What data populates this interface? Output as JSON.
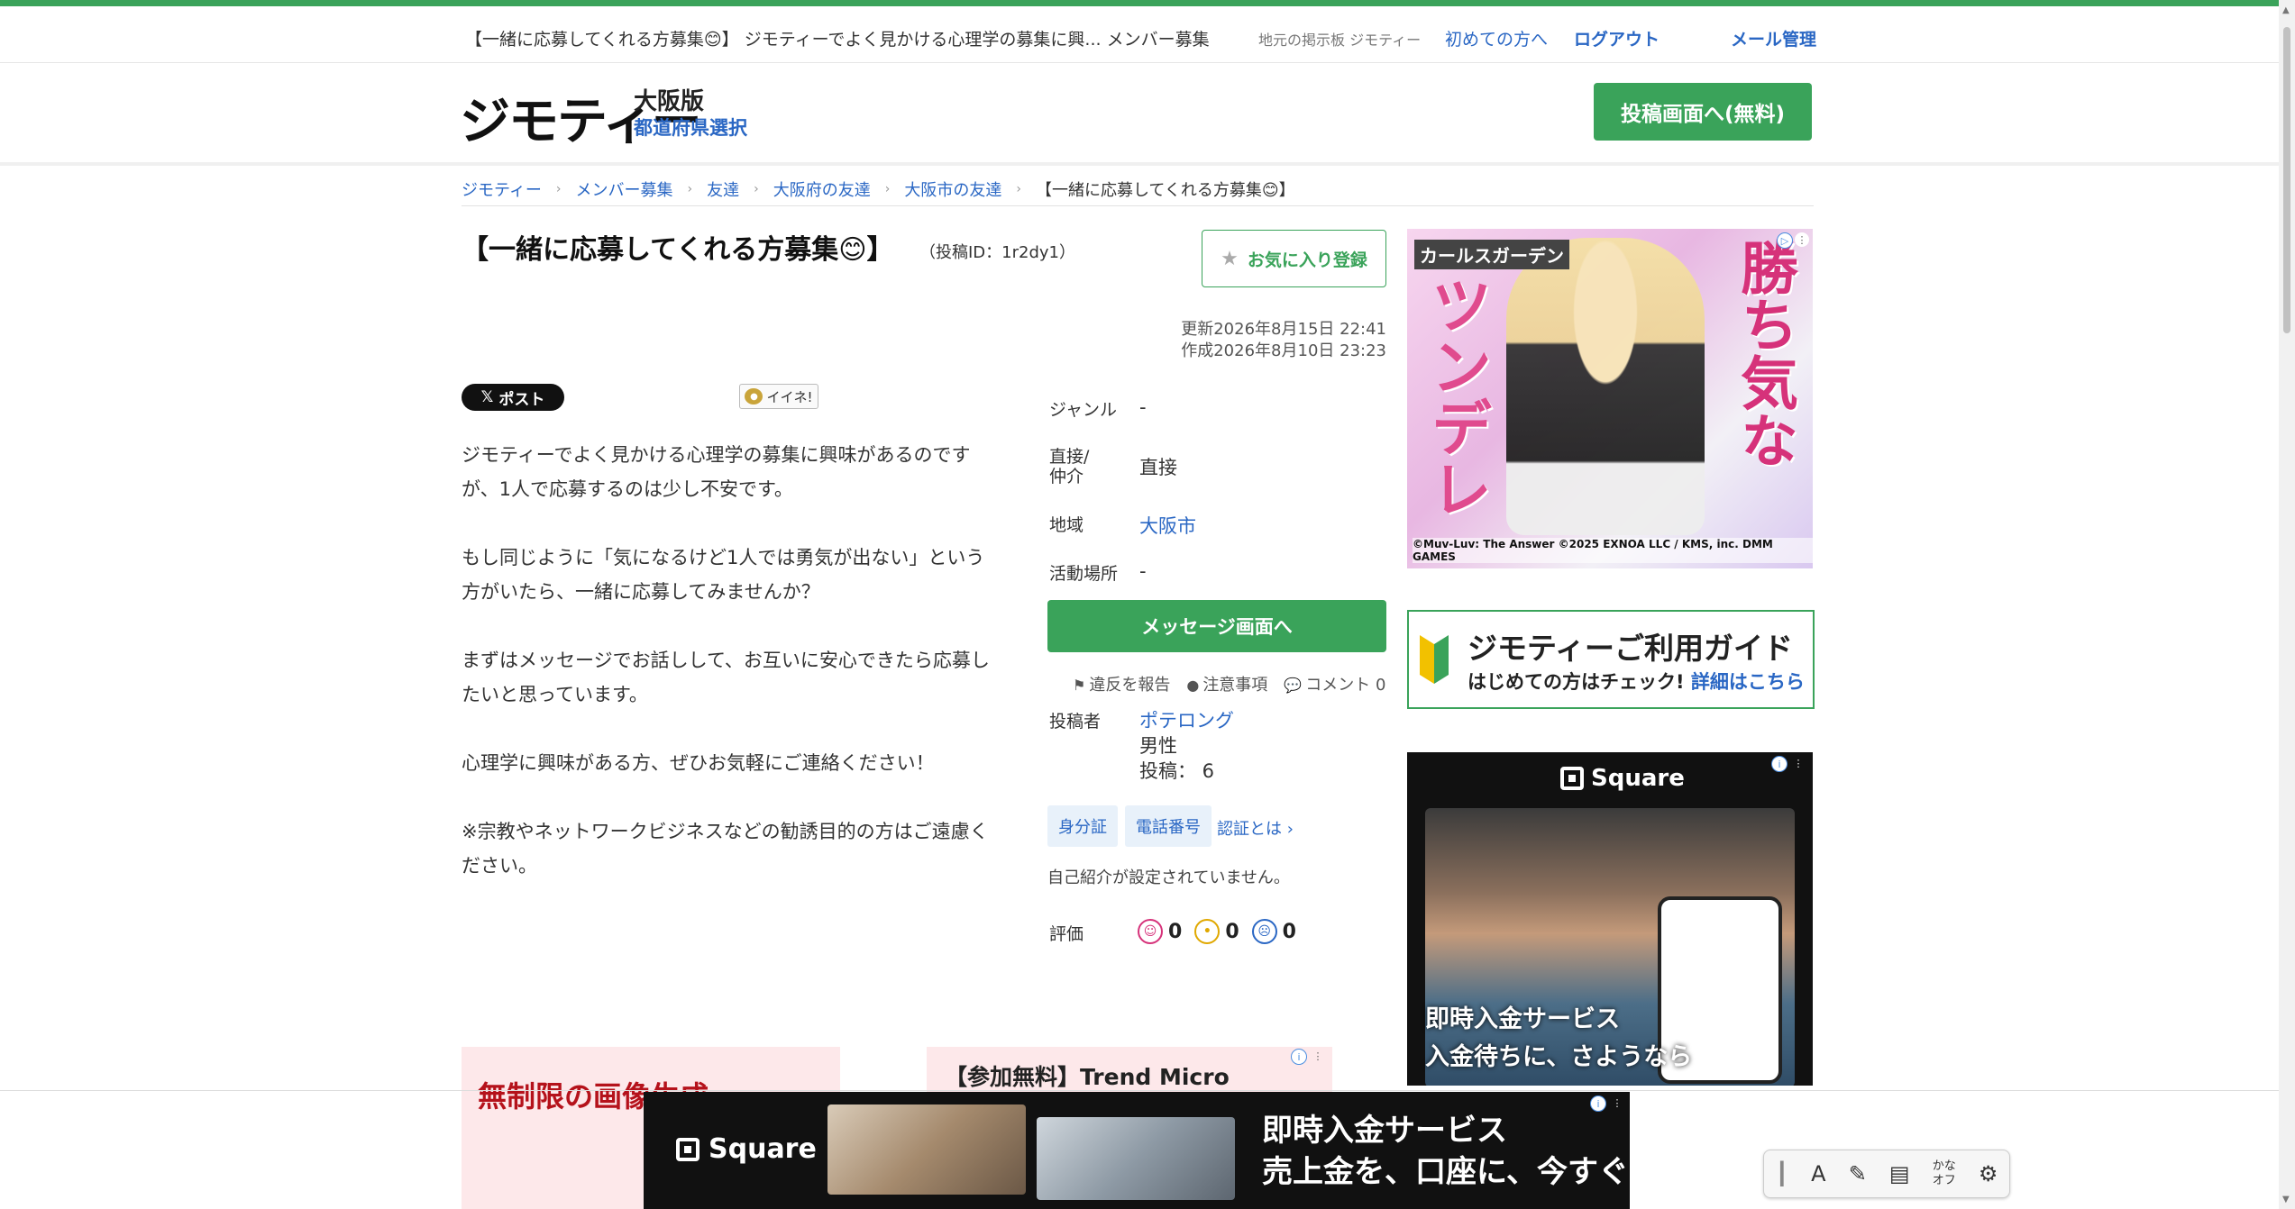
{
  "topbar": {
    "page_heading": "【一緒に応募してくれる方募集😊】 ジモティーでよく見かける心理学の募集に興... メンバー募集",
    "tagline": "地元の掲示板 ジモティー",
    "first_time": "初めての方へ",
    "logout": "ログアウト",
    "mail": "メール管理"
  },
  "header": {
    "logo": "ジモティー",
    "edition": "大阪版",
    "pref_select": "都道府県選択",
    "post_button": "投稿画面へ(無料)"
  },
  "breadcrumb": {
    "items": [
      "ジモティー",
      "メンバー募集",
      "友達",
      "大阪府の友達",
      "大阪市の友達"
    ],
    "current": "【一緒に応募してくれる方募集😊】"
  },
  "post": {
    "title": "【一緒に応募してくれる方募集😊】",
    "post_id": "（投稿ID：1r2dy1）",
    "favorite": "お気に入り登録",
    "updated": "更新2026年8月15日 22:41",
    "created": "作成2026年8月10日 23:23",
    "x_post": "ポスト",
    "iine": "イイネ!",
    "body": [
      "ジモティーでよく見かける心理学の募集に興味があるのですが、1人で応募するのは少し不安です。",
      "もし同じように「気になるけど1人では勇気が出ない」という方がいたら、一緒に応募してみませんか？",
      "まずはメッセージでお話しして、お互いに安心できたら応募したいと思っています。",
      "心理学に興味がある方、ぜひお気軽にご連絡ください！",
      "※宗教やネットワークビジネスなどの勧誘目的の方はご遠慮ください。"
    ]
  },
  "details": {
    "genre_label": "ジャンル",
    "genre_value": "-",
    "direct_label_1": "直接/",
    "direct_label_2": "仲介",
    "direct_value": "直接",
    "area_label": "地域",
    "area_value": "大阪市",
    "activity_label": "活動場所",
    "activity_value": "-",
    "message_button": "メッセージ画面へ",
    "report": "違反を報告",
    "notice": "注意事項",
    "comment": "コメント 0",
    "poster_label": "投稿者",
    "poster_name": "ポテロング",
    "poster_gender": "男性",
    "poster_posts": "投稿： 6",
    "badge_id": "身分証",
    "badge_phone": "電話番号",
    "verify_link": "認証とは ›",
    "self_intro": "自己紹介が設定されていません。",
    "rating_label": "評価",
    "rating_good": "0",
    "rating_normal": "0",
    "rating_bad": "0"
  },
  "ads": {
    "anime_brand": "カールスガーデン",
    "anime_kanji_right": "勝ち気な",
    "anime_kanji_left": "ツンデレ",
    "anime_copy": "©Muv-Luv: The Answer ©2025 EXNOA LLC / KMS, inc.  DMM GAMES",
    "guide_title": "ジモティーご利用ガイド",
    "guide_sub": "はじめての方はチェック!",
    "guide_link": "詳細はこちら",
    "square_brand": "Square",
    "square_text_1": "即時入金サービス",
    "square_text_2": "入金待ちに、さようなら",
    "bottom_left_text": "無制限の画像生成",
    "bottom_mid_text": "【参加無料】Trend Micro",
    "sticky_brand": "Square",
    "sticky_text_1": "即時入金サービス",
    "sticky_text_2": "売上金を、口座に、今すぐ"
  },
  "ime": {
    "kana_top": "かな",
    "kana_bottom": "オフ"
  },
  "colors": {
    "accent": "#3aa35a",
    "link": "#2a67c4"
  }
}
